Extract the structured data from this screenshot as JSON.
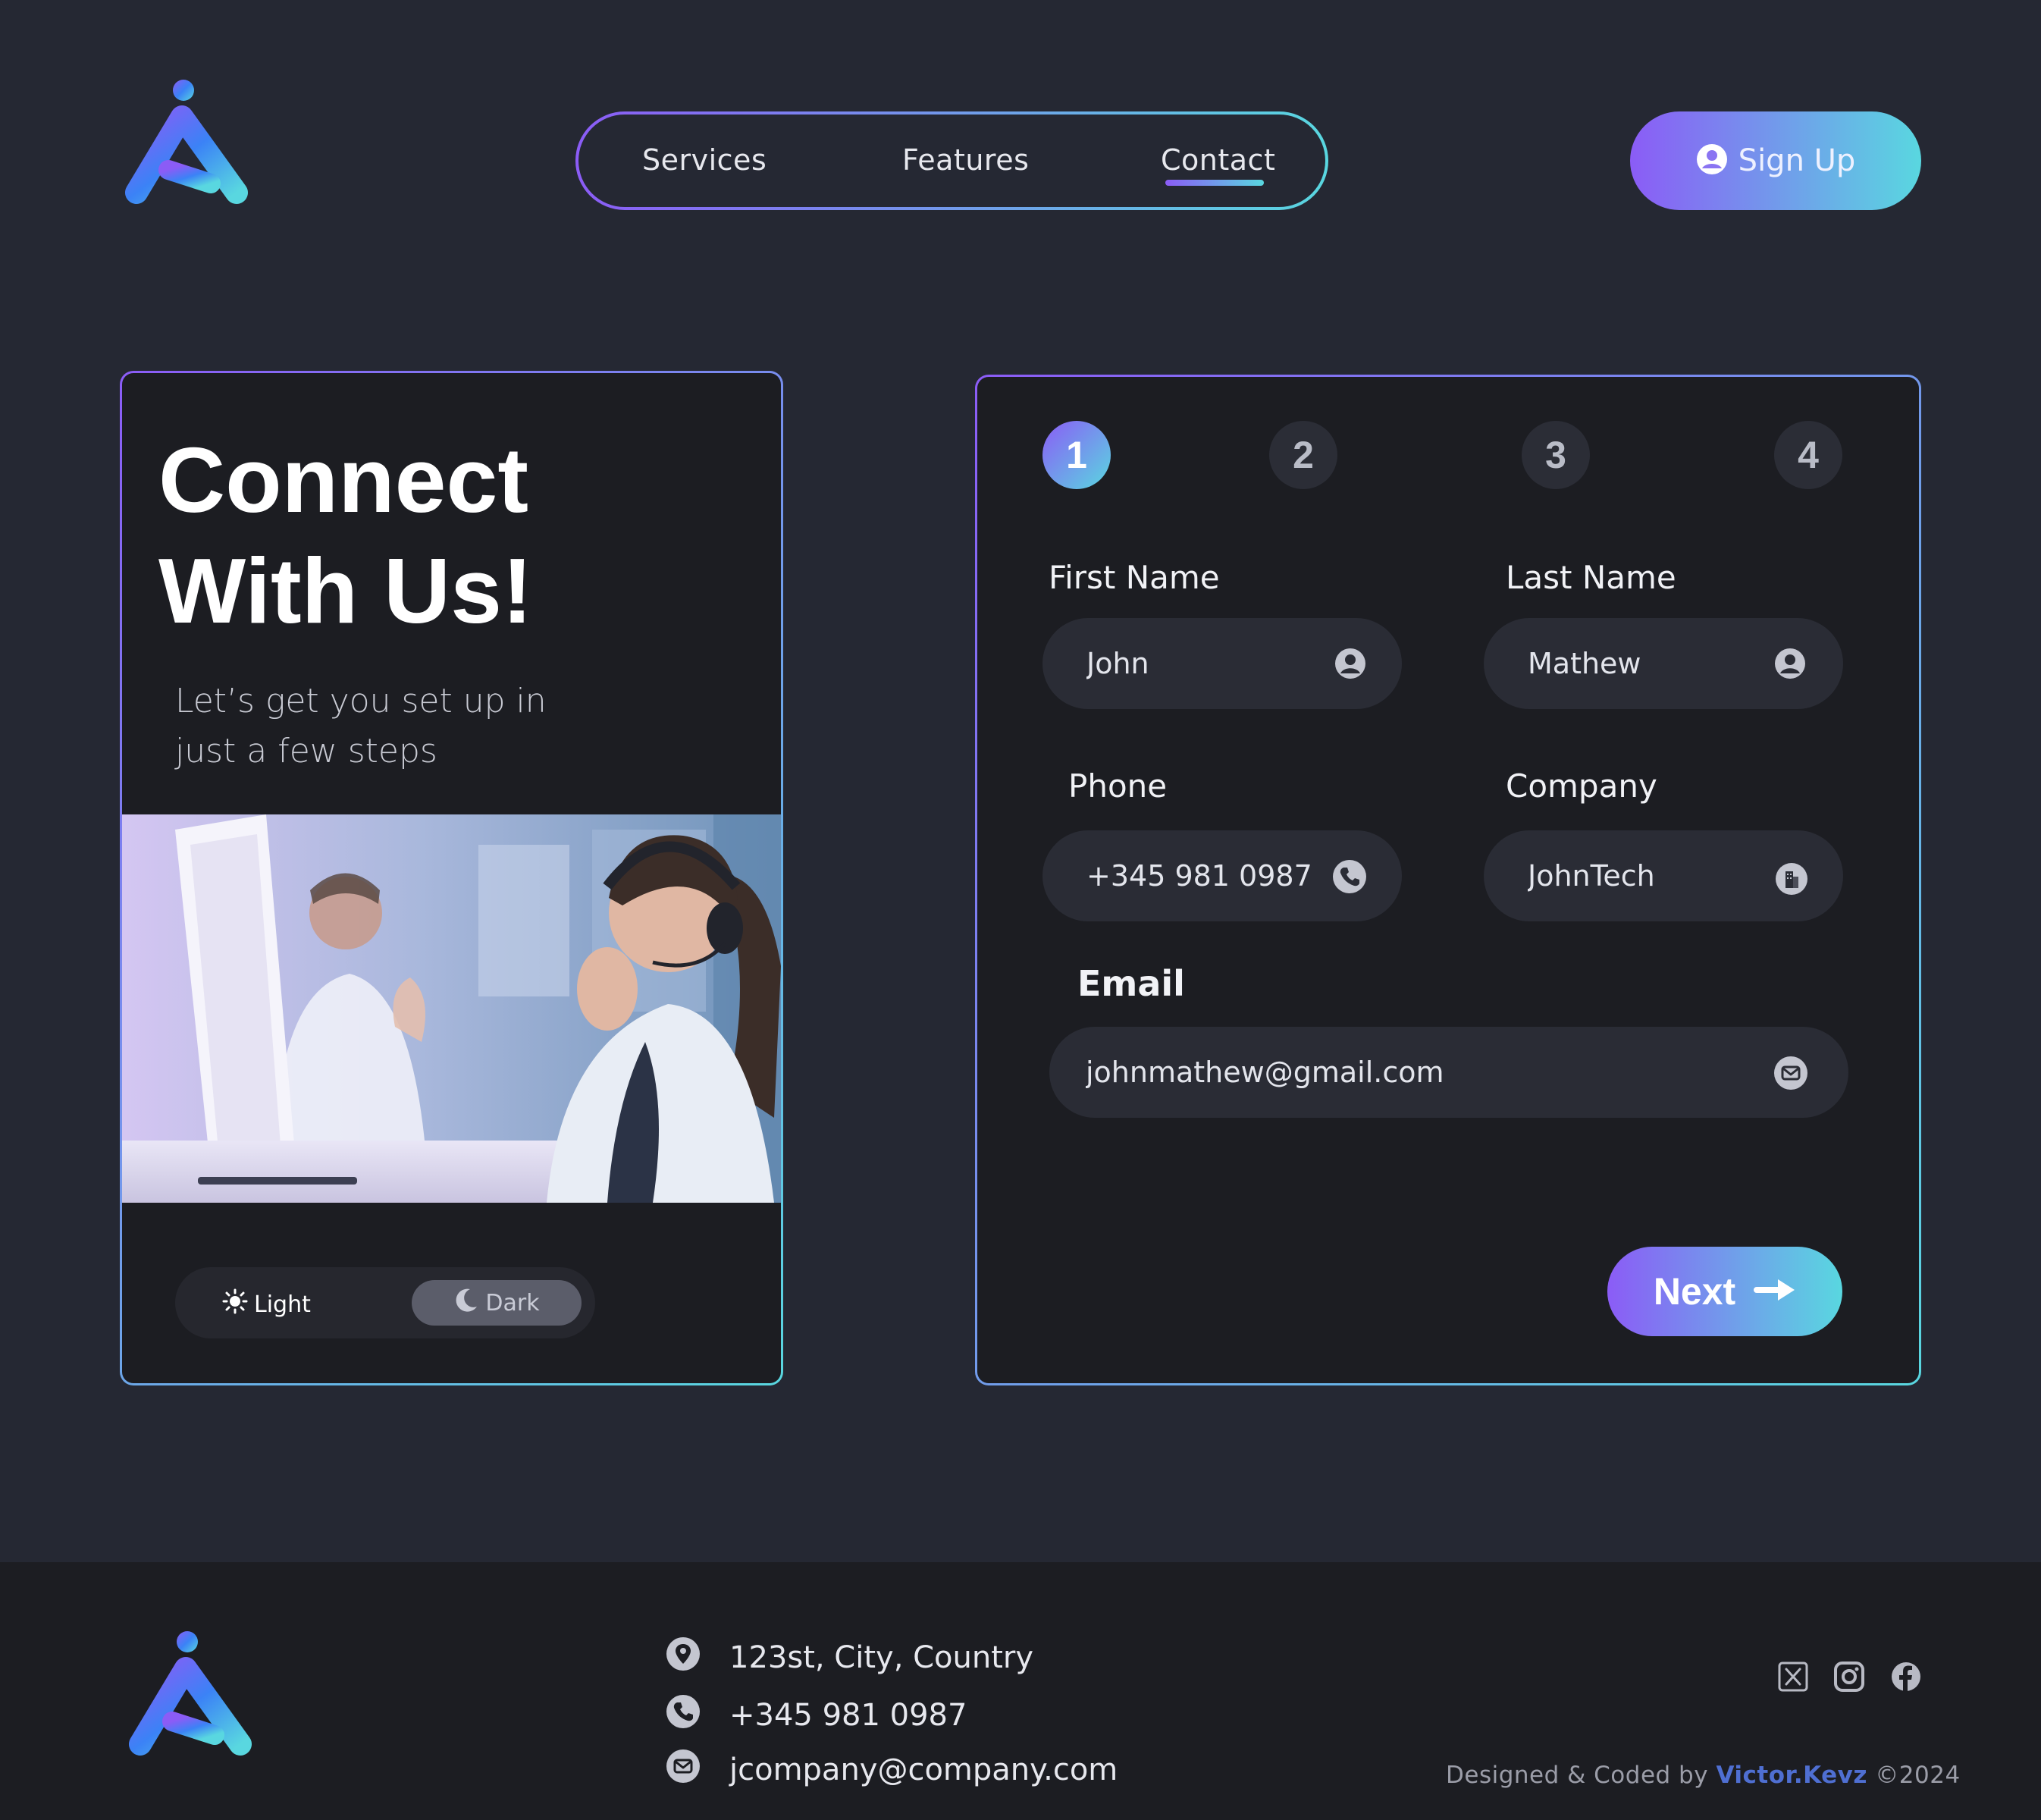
{
  "nav": {
    "links": [
      "Services",
      "Features",
      "Contact"
    ],
    "active": "Contact"
  },
  "signup": {
    "label": "Sign Up"
  },
  "hero": {
    "title_line1": "Connect",
    "title_line2": "With Us!",
    "subtitle_line1": "Let’s get you set up in",
    "subtitle_line2": "just a few steps"
  },
  "theme": {
    "light_label": "Light",
    "dark_label": "Dark",
    "selected": "Dark"
  },
  "steps": {
    "items": [
      "1",
      "2",
      "3",
      "4"
    ],
    "active": "1"
  },
  "form": {
    "first_name": {
      "label": "First Name",
      "value": "John",
      "icon": "user-icon"
    },
    "last_name": {
      "label": "Last Name",
      "value": "Mathew",
      "icon": "user-icon"
    },
    "phone": {
      "label": "Phone",
      "value": "+345 981 0987",
      "icon": "phone-icon"
    },
    "company": {
      "label": "Company",
      "value": "JohnTech",
      "icon": "building-icon"
    },
    "email": {
      "label": "Email",
      "value": "johnmathew@gmail.com",
      "icon": "mail-icon"
    },
    "next_label": "Next"
  },
  "footer": {
    "address": "123st, City, Country",
    "phone": "+345 981 0987",
    "email": "jcompany@company.com",
    "credit_prefix": "Designed & Coded by",
    "credit_author": "Victor.Kevz",
    "credit_year": "©2024",
    "social": [
      "x-icon",
      "instagram-icon",
      "facebook-icon"
    ]
  },
  "colors": {
    "background": "#252833",
    "card": "#1c1d22",
    "input": "#2a2c35",
    "accent_start": "#8b5cf6",
    "accent_end": "#59d7e0",
    "credit_link": "#4f6fd2"
  }
}
